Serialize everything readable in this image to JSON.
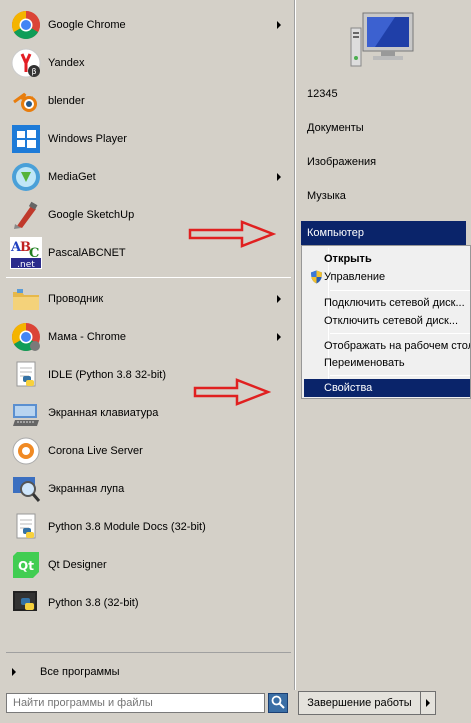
{
  "programs": [
    {
      "label": "Google Chrome",
      "icon": "chrome-icon",
      "submenu": true
    },
    {
      "label": "Yandex",
      "icon": "yandex-icon",
      "submenu": false
    },
    {
      "label": "blender",
      "icon": "blender-icon",
      "submenu": false
    },
    {
      "label": "Windows Player",
      "icon": "windows-player-icon",
      "submenu": false
    },
    {
      "label": "MediaGet",
      "icon": "mediaget-icon",
      "submenu": true
    },
    {
      "label": "Google SketchUp",
      "icon": "sketchup-icon",
      "submenu": false
    },
    {
      "label": "PascalABCNET",
      "icon": "pascalabc-icon",
      "submenu": false
    }
  ],
  "recent": [
    {
      "label": "Проводник",
      "icon": "explorer-icon",
      "submenu": true
    },
    {
      "label": "Мама - Chrome",
      "icon": "chrome-icon",
      "submenu": true
    },
    {
      "label": "IDLE (Python 3.8 32-bit)",
      "icon": "python-idle-icon",
      "submenu": false
    },
    {
      "label": "Экранная клавиатура",
      "icon": "keyboard-icon",
      "submenu": false
    },
    {
      "label": "Corona Live Server",
      "icon": "corona-icon",
      "submenu": false
    },
    {
      "label": "Экранная лупа",
      "icon": "magnifier-icon",
      "submenu": false
    },
    {
      "label": "Python 3.8 Module Docs (32-bit)",
      "icon": "python-docs-icon",
      "submenu": false
    },
    {
      "label": "Qt Designer",
      "icon": "qt-designer-icon",
      "submenu": false
    },
    {
      "label": "Python 3.8 (32-bit)",
      "icon": "python-icon",
      "submenu": false
    }
  ],
  "all_programs": "Все программы",
  "right": {
    "user": "12345",
    "documents": "Документы",
    "images": "Изображения",
    "music": "Музыка",
    "computer": "Компьютер"
  },
  "context_menu": {
    "open": "Открыть",
    "manage": "Управление",
    "map_drive": "Подключить сетевой диск...",
    "disconnect_drive": "Отключить сетевой диск...",
    "show_desktop": "Отображать на рабочем столе",
    "rename": "Переименовать",
    "properties": "Свойства"
  },
  "search": {
    "placeholder": "Найти программы и файлы"
  },
  "shutdown": {
    "label": "Завершение работы"
  },
  "colors": {
    "highlight": "#0a246a",
    "annotation_arrow": "#e02020"
  }
}
